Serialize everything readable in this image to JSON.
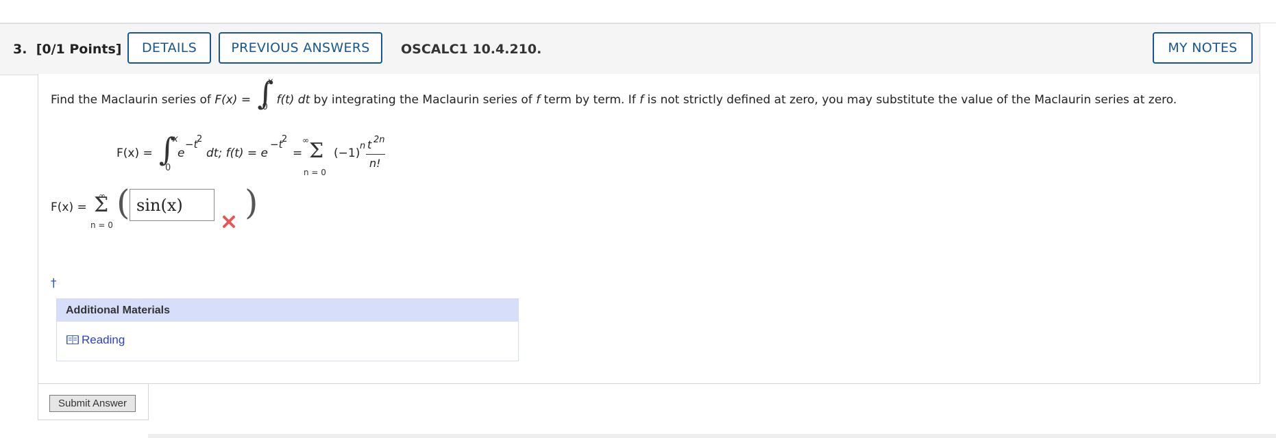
{
  "question": {
    "number_label": "3.",
    "points_label": "[0/1 Points]",
    "details_button": "DETAILS",
    "previous_answers_button": "PREVIOUS ANSWERS",
    "problem_code": "OSCALC1 10.4.210.",
    "my_notes_button": "MY NOTES"
  },
  "prompt": {
    "part1": "Find the Maclaurin series of ",
    "F_of_x": "F(x)",
    "equals": " = ",
    "integrand": "f(t) dt",
    "part2": " by integrating the Maclaurin series of ",
    "f_symbol": "f",
    "part3": " term by term. If ",
    "part4": " is not strictly defined at zero, you may substitute the value of the Maclaurin series at zero.",
    "upper_limit": "x",
    "lower_limit": "0"
  },
  "given": {
    "lhs": "F(x) =",
    "integrand_base": "e",
    "integrand_exp": "−t",
    "integrand_exp_power": "2",
    "dt_part": "dt; f(t) = e",
    "f_exp": "−t",
    "f_exp_power": "2",
    "eq": "=",
    "sum_upper": "∞",
    "sum_lower": "n = 0",
    "term_sign": "(−1)",
    "term_sign_exp": "n",
    "numerator": "t",
    "numerator_exp": "2n",
    "denominator": "n!"
  },
  "answer": {
    "lhs": "F(x) =",
    "sum_upper": "∞",
    "sum_lower": "n = 0",
    "entered_value": "sin(x)",
    "status_icon": "incorrect-x-icon",
    "status_color": "#e85757"
  },
  "footnote_marker": "†",
  "additional_materials": {
    "heading": "Additional Materials",
    "link_label": "Reading",
    "link_icon": "book-icon"
  },
  "submit_label": "Submit Answer",
  "colors": {
    "button_border": "#17568f",
    "header_bg": "#f5f5f5",
    "materials_head_bg": "#d7defa",
    "link": "#2940c8"
  }
}
